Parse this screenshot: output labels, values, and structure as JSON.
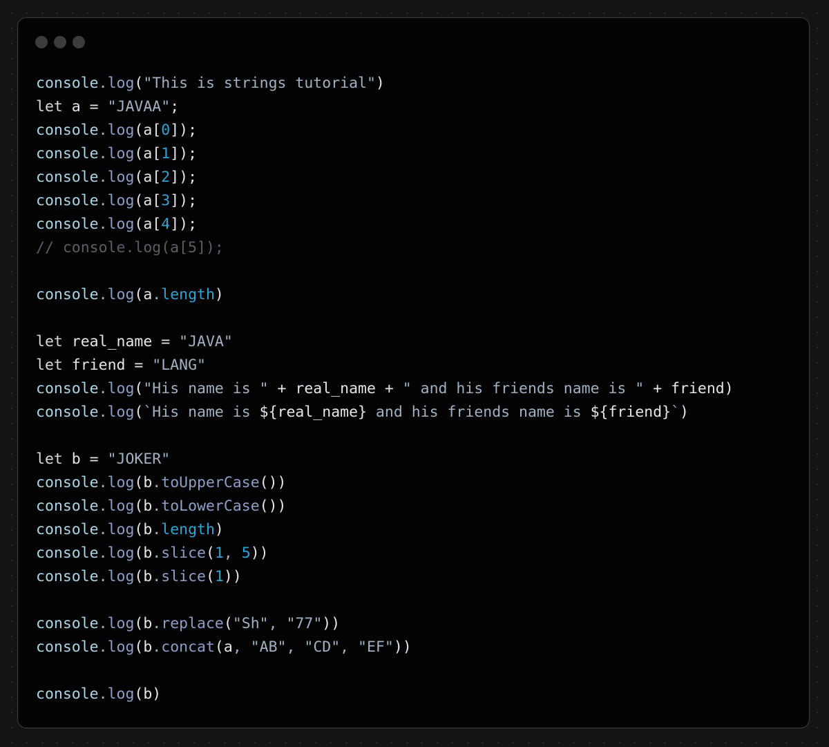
{
  "window": {
    "controls": [
      "close",
      "minimize",
      "maximize"
    ],
    "colors": {
      "background": "#030303",
      "plain": "#e4e6eb",
      "object": "#aad6ea",
      "method": "#8c9fc9",
      "string": "#9fb1c3",
      "number": "#2aa5d8",
      "comment": "#5a5e66"
    }
  },
  "code": {
    "language": "javascript",
    "lines": [
      [
        {
          "t": "obj",
          "v": "console"
        },
        {
          "t": "punc",
          "v": "."
        },
        {
          "t": "method",
          "v": "log"
        },
        {
          "t": "plain",
          "v": "("
        },
        {
          "t": "string",
          "v": "\"This is strings tutorial\""
        },
        {
          "t": "plain",
          "v": ")"
        }
      ],
      [
        {
          "t": "keyword",
          "v": "let"
        },
        {
          "t": "plain",
          "v": " a = "
        },
        {
          "t": "string",
          "v": "\"JAVAA\""
        },
        {
          "t": "plain",
          "v": ";"
        }
      ],
      [
        {
          "t": "obj",
          "v": "console"
        },
        {
          "t": "punc",
          "v": "."
        },
        {
          "t": "method",
          "v": "log"
        },
        {
          "t": "plain",
          "v": "(a["
        },
        {
          "t": "number",
          "v": "0"
        },
        {
          "t": "plain",
          "v": "]);"
        }
      ],
      [
        {
          "t": "obj",
          "v": "console"
        },
        {
          "t": "punc",
          "v": "."
        },
        {
          "t": "method",
          "v": "log"
        },
        {
          "t": "plain",
          "v": "(a["
        },
        {
          "t": "number",
          "v": "1"
        },
        {
          "t": "plain",
          "v": "]);"
        }
      ],
      [
        {
          "t": "obj",
          "v": "console"
        },
        {
          "t": "punc",
          "v": "."
        },
        {
          "t": "method",
          "v": "log"
        },
        {
          "t": "plain",
          "v": "(a["
        },
        {
          "t": "number",
          "v": "2"
        },
        {
          "t": "plain",
          "v": "]);"
        }
      ],
      [
        {
          "t": "obj",
          "v": "console"
        },
        {
          "t": "punc",
          "v": "."
        },
        {
          "t": "method",
          "v": "log"
        },
        {
          "t": "plain",
          "v": "(a["
        },
        {
          "t": "number",
          "v": "3"
        },
        {
          "t": "plain",
          "v": "]);"
        }
      ],
      [
        {
          "t": "obj",
          "v": "console"
        },
        {
          "t": "punc",
          "v": "."
        },
        {
          "t": "method",
          "v": "log"
        },
        {
          "t": "plain",
          "v": "(a["
        },
        {
          "t": "number",
          "v": "4"
        },
        {
          "t": "plain",
          "v": "]);"
        }
      ],
      [
        {
          "t": "comment",
          "v": "// console.log(a[5]);"
        }
      ],
      [],
      [
        {
          "t": "obj",
          "v": "console"
        },
        {
          "t": "punc",
          "v": "."
        },
        {
          "t": "method",
          "v": "log"
        },
        {
          "t": "plain",
          "v": "(a"
        },
        {
          "t": "punc",
          "v": "."
        },
        {
          "t": "prop",
          "v": "length"
        },
        {
          "t": "plain",
          "v": ")"
        }
      ],
      [],
      [
        {
          "t": "keyword",
          "v": "let"
        },
        {
          "t": "plain",
          "v": " real_name = "
        },
        {
          "t": "string",
          "v": "\"JAVA\""
        }
      ],
      [
        {
          "t": "keyword",
          "v": "let"
        },
        {
          "t": "plain",
          "v": " friend = "
        },
        {
          "t": "string",
          "v": "\"LANG\""
        }
      ],
      [
        {
          "t": "obj",
          "v": "console"
        },
        {
          "t": "punc",
          "v": "."
        },
        {
          "t": "method",
          "v": "log"
        },
        {
          "t": "plain",
          "v": "("
        },
        {
          "t": "string",
          "v": "\"His name is \""
        },
        {
          "t": "plain",
          "v": " + real_name + "
        },
        {
          "t": "string",
          "v": "\" and his friends name is \""
        },
        {
          "t": "plain",
          "v": " + friend)"
        }
      ],
      [
        {
          "t": "obj",
          "v": "console"
        },
        {
          "t": "punc",
          "v": "."
        },
        {
          "t": "method",
          "v": "log"
        },
        {
          "t": "plain",
          "v": "("
        },
        {
          "t": "string",
          "v": "`His name is "
        },
        {
          "t": "plain",
          "v": "${real_name}"
        },
        {
          "t": "string",
          "v": " and his friends name is "
        },
        {
          "t": "plain",
          "v": "${friend}"
        },
        {
          "t": "string",
          "v": "`"
        },
        {
          "t": "plain",
          "v": ")"
        }
      ],
      [],
      [
        {
          "t": "keyword",
          "v": "let"
        },
        {
          "t": "plain",
          "v": " b = "
        },
        {
          "t": "string",
          "v": "\"JOKER\""
        }
      ],
      [
        {
          "t": "obj",
          "v": "console"
        },
        {
          "t": "punc",
          "v": "."
        },
        {
          "t": "method",
          "v": "log"
        },
        {
          "t": "plain",
          "v": "(b"
        },
        {
          "t": "punc",
          "v": "."
        },
        {
          "t": "method",
          "v": "toUpperCase"
        },
        {
          "t": "plain",
          "v": "())"
        }
      ],
      [
        {
          "t": "obj",
          "v": "console"
        },
        {
          "t": "punc",
          "v": "."
        },
        {
          "t": "method",
          "v": "log"
        },
        {
          "t": "plain",
          "v": "(b"
        },
        {
          "t": "punc",
          "v": "."
        },
        {
          "t": "method",
          "v": "toLowerCase"
        },
        {
          "t": "plain",
          "v": "())"
        }
      ],
      [
        {
          "t": "obj",
          "v": "console"
        },
        {
          "t": "punc",
          "v": "."
        },
        {
          "t": "method",
          "v": "log"
        },
        {
          "t": "plain",
          "v": "(b"
        },
        {
          "t": "punc",
          "v": "."
        },
        {
          "t": "prop",
          "v": "length"
        },
        {
          "t": "plain",
          "v": ")"
        }
      ],
      [
        {
          "t": "obj",
          "v": "console"
        },
        {
          "t": "punc",
          "v": "."
        },
        {
          "t": "method",
          "v": "log"
        },
        {
          "t": "plain",
          "v": "(b"
        },
        {
          "t": "punc",
          "v": "."
        },
        {
          "t": "method",
          "v": "slice"
        },
        {
          "t": "plain",
          "v": "("
        },
        {
          "t": "number",
          "v": "1"
        },
        {
          "t": "punc",
          "v": ", "
        },
        {
          "t": "number",
          "v": "5"
        },
        {
          "t": "plain",
          "v": "))"
        }
      ],
      [
        {
          "t": "obj",
          "v": "console"
        },
        {
          "t": "punc",
          "v": "."
        },
        {
          "t": "method",
          "v": "log"
        },
        {
          "t": "plain",
          "v": "(b"
        },
        {
          "t": "punc",
          "v": "."
        },
        {
          "t": "method",
          "v": "slice"
        },
        {
          "t": "plain",
          "v": "("
        },
        {
          "t": "number",
          "v": "1"
        },
        {
          "t": "plain",
          "v": "))"
        }
      ],
      [],
      [
        {
          "t": "obj",
          "v": "console"
        },
        {
          "t": "punc",
          "v": "."
        },
        {
          "t": "method",
          "v": "log"
        },
        {
          "t": "plain",
          "v": "(b"
        },
        {
          "t": "punc",
          "v": "."
        },
        {
          "t": "method",
          "v": "replace"
        },
        {
          "t": "plain",
          "v": "("
        },
        {
          "t": "string",
          "v": "\"Sh\""
        },
        {
          "t": "punc",
          "v": ", "
        },
        {
          "t": "string",
          "v": "\"77\""
        },
        {
          "t": "plain",
          "v": "))"
        }
      ],
      [
        {
          "t": "obj",
          "v": "console"
        },
        {
          "t": "punc",
          "v": "."
        },
        {
          "t": "method",
          "v": "log"
        },
        {
          "t": "plain",
          "v": "(b"
        },
        {
          "t": "punc",
          "v": "."
        },
        {
          "t": "method",
          "v": "concat"
        },
        {
          "t": "plain",
          "v": "(a"
        },
        {
          "t": "punc",
          "v": ", "
        },
        {
          "t": "string",
          "v": "\"AB\""
        },
        {
          "t": "punc",
          "v": ", "
        },
        {
          "t": "string",
          "v": "\"CD\""
        },
        {
          "t": "punc",
          "v": ", "
        },
        {
          "t": "string",
          "v": "\"EF\""
        },
        {
          "t": "plain",
          "v": "))"
        }
      ],
      [],
      [
        {
          "t": "obj",
          "v": "console"
        },
        {
          "t": "punc",
          "v": "."
        },
        {
          "t": "method",
          "v": "log"
        },
        {
          "t": "plain",
          "v": "(b)"
        }
      ]
    ]
  }
}
